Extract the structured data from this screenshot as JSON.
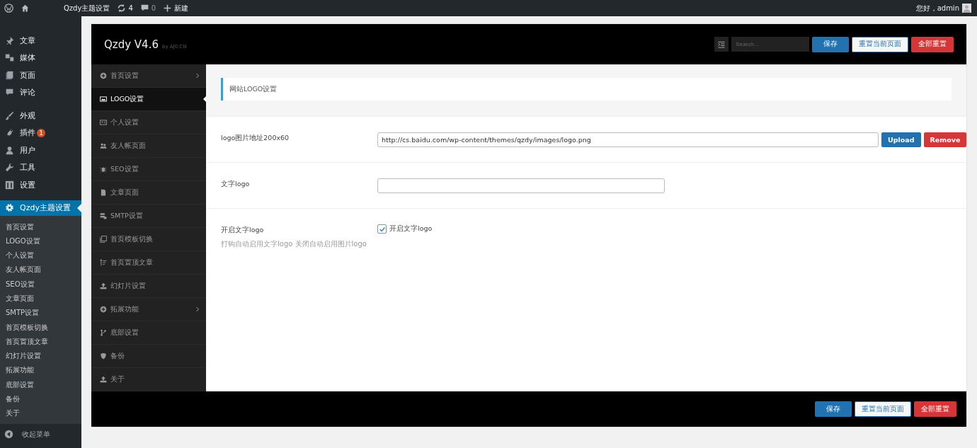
{
  "admin_bar": {
    "site_name": "Qzdy主题设置",
    "updates": "4",
    "comments": "0",
    "new_label": "新建",
    "greeting": "您好，admin"
  },
  "sidebar": {
    "items": [
      {
        "label": "文章",
        "selected": false
      },
      {
        "label": "媒体",
        "selected": false
      },
      {
        "label": "页面",
        "selected": false
      },
      {
        "label": "评论",
        "selected": false
      },
      {
        "label": "外观",
        "selected": false
      },
      {
        "label": "插件",
        "selected": false,
        "badge": "1"
      },
      {
        "label": "用户",
        "selected": false
      },
      {
        "label": "工具",
        "selected": false
      },
      {
        "label": "设置",
        "selected": false
      },
      {
        "label": "Qzdy主题设置",
        "selected": true
      }
    ],
    "submenu": [
      "首页设置",
      "LOGO设置",
      "个人设置",
      "友人帐页面",
      "SEO设置",
      "文章页面",
      "SMTP设置",
      "首页模板切换",
      "首页置顶文章",
      "幻灯片设置",
      "拓展功能",
      "底部设置",
      "备份",
      "关于"
    ],
    "collapse": "收起菜单"
  },
  "panel": {
    "title": "Qzdy V4.6",
    "byline": "by AJ0.CN",
    "search": {
      "placeholder": "Search..."
    },
    "buttons": [
      {
        "label": "保存",
        "kind": "primary"
      },
      {
        "label": "重置当前页面",
        "kind": "default"
      },
      {
        "label": "全部重置",
        "kind": "danger"
      }
    ],
    "nav": [
      {
        "label": "首页设置",
        "selected": false,
        "has_children": true
      },
      {
        "label": "LOGO设置",
        "selected": true,
        "has_children": false
      },
      {
        "label": "个人设置",
        "selected": false,
        "has_children": false
      },
      {
        "label": "友人帐页面",
        "selected": false,
        "has_children": false
      },
      {
        "label": "SEO设置",
        "selected": false,
        "has_children": false
      },
      {
        "label": "文章页面",
        "selected": false,
        "has_children": false
      },
      {
        "label": "SMTP设置",
        "selected": false,
        "has_children": false
      },
      {
        "label": "首页模板切换",
        "selected": false,
        "has_children": false
      },
      {
        "label": "首页置顶文章",
        "selected": false,
        "has_children": false
      },
      {
        "label": "幻灯片设置",
        "selected": false,
        "has_children": false
      },
      {
        "label": "拓展功能",
        "selected": false,
        "has_children": true
      },
      {
        "label": "底部设置",
        "selected": false,
        "has_children": false
      },
      {
        "label": "备份",
        "selected": false,
        "has_children": false
      },
      {
        "label": "关于",
        "selected": false,
        "has_children": false
      }
    ],
    "section_title": "网站LOGO设置",
    "fields": [
      {
        "kind": "upload",
        "label": "logo图片地址200x60",
        "value": "http://cs.baidu.com/wp-content/themes/qzdy/images/logo.png",
        "buttons": [
          {
            "label": "Upload",
            "kind": "primary"
          },
          {
            "label": "Remove",
            "kind": "danger"
          }
        ]
      },
      {
        "kind": "text",
        "label": "文字logo"
      },
      {
        "kind": "checkbox",
        "label": "开启文字logo",
        "description": "打钩自动启用文字logo 关闭自动启用图片logo",
        "option": "开启文字logo",
        "checked": true
      }
    ],
    "footer_buttons": [
      {
        "label": "保存",
        "kind": "primary"
      },
      {
        "label": "重置当前页面",
        "kind": "default"
      },
      {
        "label": "全部重置",
        "kind": "danger"
      }
    ]
  }
}
